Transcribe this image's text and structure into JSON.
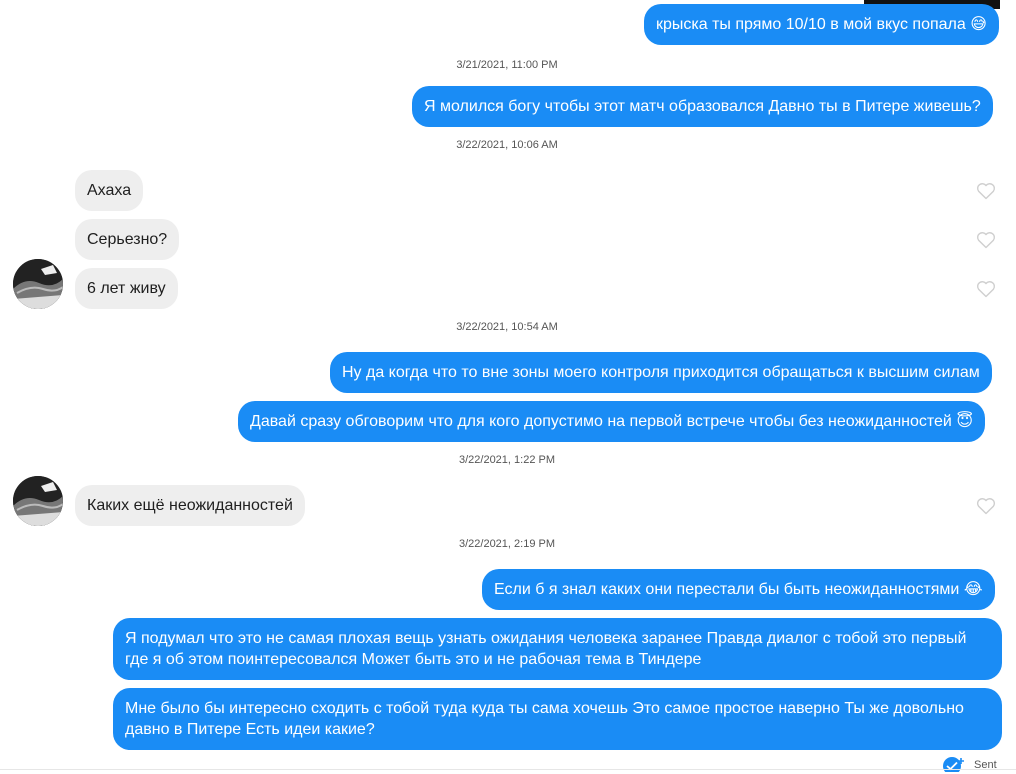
{
  "messages": [
    {
      "text": "крыска ты прямо 10/10 в мой вкус попала 😅"
    },
    {
      "text": "Я молился богу чтобы этот матч образовался  Давно ты в Питере живешь?"
    },
    {
      "text": "Ахаха"
    },
    {
      "text": "Серьезно?"
    },
    {
      "text": "6 лет живу"
    },
    {
      "text": "Ну да когда что то вне зоны моего контроля приходится обращаться к высшим силам"
    },
    {
      "text": "Давай сразу обговорим что для кого допустимо на первой встрече чтобы без неожиданностей 😇"
    },
    {
      "text": "Каких ещё неожиданностей"
    },
    {
      "text": "Если б я знал каких они перестали бы быть неожиданностями 😂"
    },
    {
      "text": "Я подумал что это не самая плохая вещь узнать ожидания человека заранее Правда диалог с тобой это первый где я об этом поинтересовался Может быть это и не рабочая тема в Тиндере"
    },
    {
      "text": "Мне было бы интересно сходить с тобой туда куда ты сама хочешь Это самое простое наверно Ты же довольно давно в Питере Есть идеи какие?"
    }
  ],
  "timestamps": [
    "3/21/2021, 11:00 PM",
    "3/22/2021, 10:06 AM",
    "3/22/2021, 10:54 AM",
    "3/22/2021, 1:22 PM",
    "3/22/2021, 2:19 PM"
  ],
  "status": {
    "sent_label": "Sent"
  },
  "colors": {
    "outgoing_bubble": "#1a8cf5",
    "incoming_bubble": "#eeeeee",
    "text_on_outgoing": "#ffffff"
  }
}
